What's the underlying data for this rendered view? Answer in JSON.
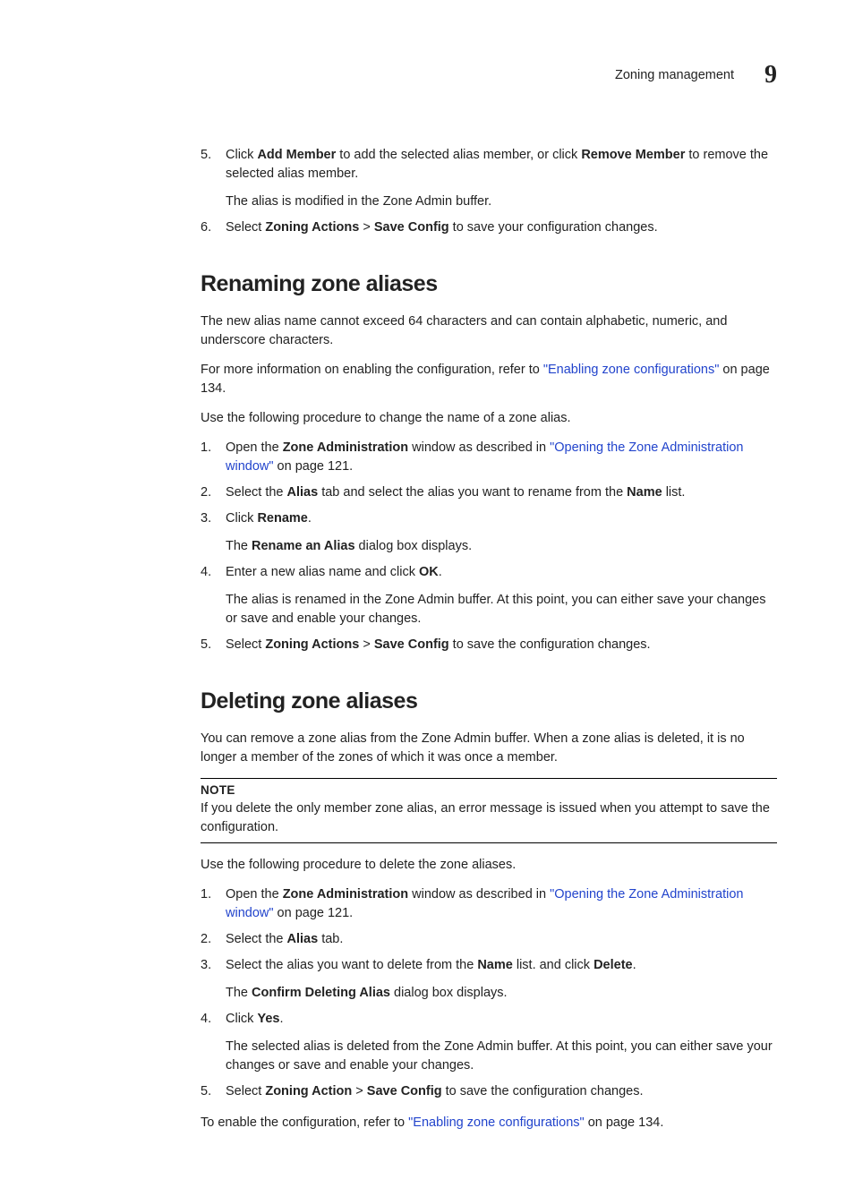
{
  "header": {
    "title": "Zoning management",
    "chapter": "9"
  },
  "section0": {
    "step5_num": "5.",
    "step5_a": "Click ",
    "step5_b": "Add Member",
    "step5_c": " to add the selected alias member, or click ",
    "step5_d": "Remove Member",
    "step5_e": " to remove the selected alias member.",
    "step5_sub": "The alias is modified in the Zone Admin buffer.",
    "step6_num": "6.",
    "step6_a": "Select ",
    "step6_b": "Zoning Actions",
    "step6_c": " > ",
    "step6_d": "Save Config",
    "step6_e": " to save your configuration changes."
  },
  "section1": {
    "heading": "Renaming zone aliases",
    "p1": "The new alias name cannot exceed 64 characters and can contain alphabetic, numeric, and underscore characters.",
    "p2_a": "For more information on enabling the configuration, refer to ",
    "p2_link": "\"Enabling zone configurations\"",
    "p2_b": " on page 134.",
    "p3": "Use the following procedure to change the name of a zone alias.",
    "step1_num": "1.",
    "step1_a": "Open the ",
    "step1_b": "Zone Administration",
    "step1_c": " window as described in ",
    "step1_link": "\"Opening the Zone Administration window\"",
    "step1_d": " on page 121.",
    "step2_num": "2.",
    "step2_a": "Select the ",
    "step2_b": "Alias",
    "step2_c": " tab and select the alias you want to rename from the ",
    "step2_d": "Name",
    "step2_e": " list.",
    "step3_num": "3.",
    "step3_a": "Click ",
    "step3_b": "Rename",
    "step3_c": ".",
    "step3_sub_a": "The ",
    "step3_sub_b": "Rename an Alias",
    "step3_sub_c": " dialog box displays.",
    "step4_num": "4.",
    "step4_a": "Enter a new alias name and click ",
    "step4_b": "OK",
    "step4_c": ".",
    "step4_sub": "The alias is renamed in the Zone Admin buffer. At this point, you can either save your changes or save and enable your changes.",
    "step5_num": "5.",
    "step5_a": "Select ",
    "step5_b": "Zoning Actions",
    "step5_c": " > ",
    "step5_d": "Save Config",
    "step5_e": " to save the configuration changes."
  },
  "section2": {
    "heading": "Deleting zone aliases",
    "p1": "You can remove a zone alias from the Zone Admin buffer. When a zone alias is deleted, it is no longer a member of the zones of which it was once a member.",
    "note_title": "NOTE",
    "note_body": "If you delete the only member zone alias, an error message is issued when you attempt to save the configuration.",
    "p2": "Use the following procedure to delete the zone aliases.",
    "step1_num": "1.",
    "step1_a": "Open the ",
    "step1_b": "Zone Administration",
    "step1_c": " window as described in ",
    "step1_link": "\"Opening the Zone Administration window\"",
    "step1_d": " on page 121.",
    "step2_num": "2.",
    "step2_a": "Select the ",
    "step2_b": "Alias",
    "step2_c": " tab.",
    "step3_num": "3.",
    "step3_a": "Select the alias you want to delete from the ",
    "step3_b": "Name",
    "step3_c": " list. and click ",
    "step3_d": "Delete",
    "step3_e": ".",
    "step3_sub_a": "The ",
    "step3_sub_b": "Confirm Deleting Alias",
    "step3_sub_c": " dialog box displays.",
    "step4_num": "4.",
    "step4_a": "Click ",
    "step4_b": "Yes",
    "step4_c": ".",
    "step4_sub": "The selected alias is deleted from the Zone Admin buffer. At this point, you can either save your changes or save and enable your changes.",
    "step5_num": "5.",
    "step5_a": "Select ",
    "step5_b": "Zoning Action",
    "step5_c": " > ",
    "step5_d": "Save Config",
    "step5_e": " to save the configuration changes.",
    "p3_a": "To enable the configuration, refer to ",
    "p3_link": "\"Enabling zone configurations\"",
    "p3_b": " on page 134."
  }
}
